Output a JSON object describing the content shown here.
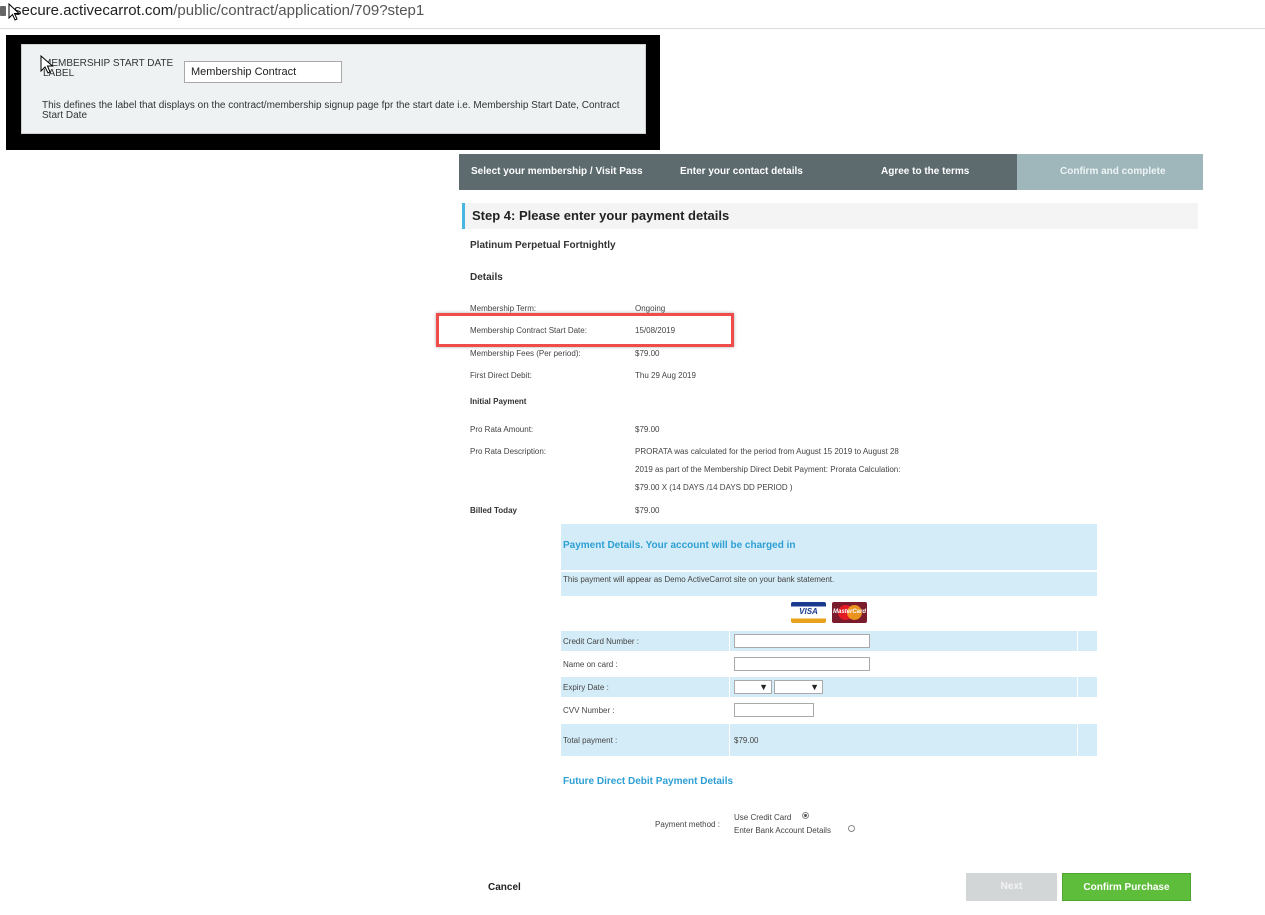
{
  "url": {
    "host": "secure.activecarrot.com",
    "path": "/public/contract/application/709?step1"
  },
  "setting": {
    "label": "MEMBERSHIP START DATE LABEL",
    "value": "Membership Contract",
    "description": "This defines the label that displays on the contract/membership signup page fpr the start date i.e. Membership Start Date, Contract Start Date"
  },
  "steps": [
    {
      "label": "Select your membership / Visit Pass"
    },
    {
      "label": "Enter your contact details"
    },
    {
      "label": "Agree to the terms"
    },
    {
      "label": "Confirm and complete"
    }
  ],
  "heading": "Step 4: Please enter your payment details",
  "plan_name": "Platinum Perpetual Fortnightly",
  "details_heading": "Details",
  "details": [
    {
      "label": "Membership Term:",
      "value": "Ongoing"
    },
    {
      "label": "Membership Contract Start Date:",
      "value": "15/08/2019"
    },
    {
      "label": "Membership Fees (Per period):",
      "value": "$79.00"
    },
    {
      "label": "First Direct Debit:",
      "value": "Thu 29 Aug 2019"
    }
  ],
  "initial_payment_heading": "Initial Payment",
  "initial": {
    "pro_rata_amount_label": "Pro Rata Amount:",
    "pro_rata_amount": "$79.00",
    "pro_rata_desc_label": "Pro Rata Description:",
    "pro_rata_desc_lines": [
      "PRORATA was calculated for the period from August 15 2019 to August 28",
      "2019 as part of the Membership Direct Debit Payment: Prorata Calculation:",
      "$79.00 X (14 DAYS /14 DAYS DD PERIOD )"
    ],
    "billed_today_label": "Billed Today",
    "billed_today": "$79.00"
  },
  "payment": {
    "header": "Payment Details. Your account will be charged in",
    "note": "This payment will appear as Demo ActiveCarrot site on your bank statement.",
    "cards": [
      "VISA",
      "MasterCard"
    ],
    "fields": {
      "card_number": "Credit Card Number :",
      "name_on_card": "Name on card :",
      "expiry": "Expiry Date :",
      "cvv": "CVV Number :",
      "total_label": "Total payment :",
      "total_value": "$79.00"
    }
  },
  "future": {
    "heading": "Future Direct Debit Payment Details",
    "method_label": "Payment method :",
    "options": [
      "Use Credit Card",
      "Enter Bank Account Details"
    ],
    "selected": 0
  },
  "buttons": {
    "cancel": "Cancel",
    "next": "Next",
    "confirm": "Confirm Purchase"
  },
  "colors": {
    "accent": "#2d9fd4",
    "highlight": "#f04c4c",
    "confirm": "#5fbd3c",
    "step_bar": "#5d6b6f"
  }
}
